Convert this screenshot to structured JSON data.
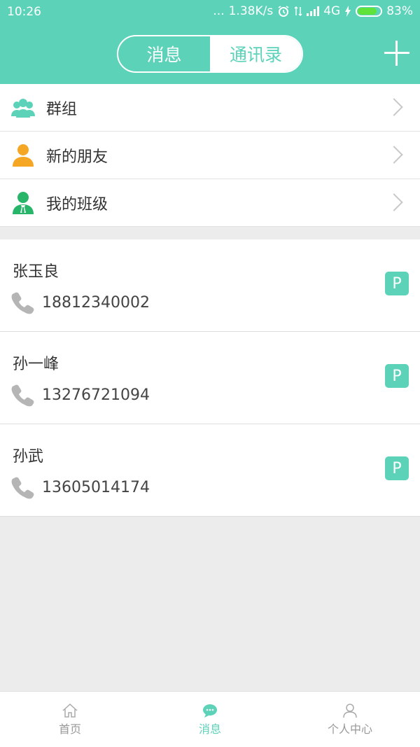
{
  "status_bar": {
    "time": "10:26",
    "dots": "...",
    "speed": "1.38K/s",
    "network": "4G",
    "battery": "83%"
  },
  "header": {
    "tabs": [
      {
        "label": "消息",
        "active": false
      },
      {
        "label": "通讯录",
        "active": true
      }
    ],
    "add_icon": "plus-icon"
  },
  "menu": [
    {
      "label": "群组",
      "icon": "group-icon"
    },
    {
      "label": "新的朋友",
      "icon": "new-friend-icon"
    },
    {
      "label": "我的班级",
      "icon": "my-class-icon"
    }
  ],
  "contacts": [
    {
      "name": "张玉良",
      "phone": "18812340002",
      "badge": "P"
    },
    {
      "name": "孙一峰",
      "phone": "13276721094",
      "badge": "P"
    },
    {
      "name": "孙武",
      "phone": "13605014174",
      "badge": "P"
    }
  ],
  "bottom_nav": [
    {
      "label": "首页",
      "icon": "home-icon",
      "active": false
    },
    {
      "label": "消息",
      "icon": "message-icon",
      "active": true
    },
    {
      "label": "个人中心",
      "icon": "person-icon",
      "active": false
    }
  ],
  "colors": {
    "accent": "#5cd2b9",
    "background": "#ececec",
    "new_friend_icon": "#f5a623",
    "class_icon": "#27b56a"
  }
}
